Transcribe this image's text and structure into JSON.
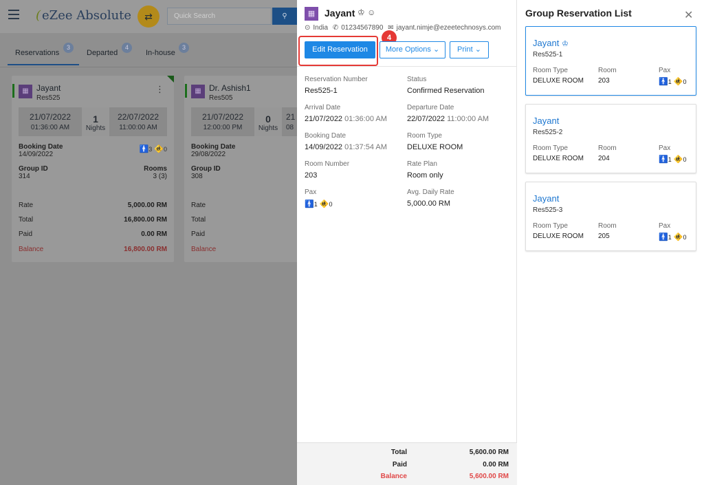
{
  "topbar": {
    "logo": "eZee Absolute",
    "search_placeholder": "Quick Search",
    "search_icon": "search-icon",
    "shuffle_icon": "shuffle-icon"
  },
  "tabs": [
    {
      "label": "Reservations",
      "count": "3"
    },
    {
      "label": "Departed",
      "count": "4"
    },
    {
      "label": "In-house",
      "count": "3"
    }
  ],
  "cards": [
    {
      "name": "Jayant",
      "res": "Res525",
      "arr_date": "21/07/2022",
      "arr_time": "01:36:00 AM",
      "nights": "1",
      "nights_label": "Nights",
      "dep_date": "22/07/2022",
      "dep_time": "11:00:00 AM",
      "booking_label": "Booking Date",
      "booking_date": "14/09/2022",
      "adults": "3",
      "children": "0",
      "group_label": "Group ID",
      "group_id": "314",
      "rooms_label": "Rooms",
      "rooms": "3 (3)",
      "rate_label": "Rate",
      "rate": "5,000.00 RM",
      "total_label": "Total",
      "total": "16,800.00 RM",
      "paid_label": "Paid",
      "paid": "0.00 RM",
      "balance_label": "Balance",
      "balance": "16,800.00 RM"
    },
    {
      "name": "Dr. Ashish1",
      "res": "Res505",
      "arr_date": "21/07/2022",
      "arr_time": "12:00:00 PM",
      "nights": "0",
      "nights_label": "Nights",
      "dep_date": "21",
      "dep_time": "08",
      "booking_label": "Booking Date",
      "booking_date": "29/08/2022",
      "group_label": "Group ID",
      "group_id": "308",
      "rate_label": "Rate",
      "total_label": "Total",
      "paid_label": "Paid",
      "balance_label": "Balance"
    }
  ],
  "panel": {
    "name": "Jayant",
    "country": "India",
    "phone": "01234567890",
    "email": "jayant.nimje@ezeetechnosys.com",
    "edit_label": "Edit Reservation",
    "step_number": "4",
    "more_label": "More Options",
    "print_label": "Print",
    "fields": {
      "res_no_label": "Reservation Number",
      "res_no": "Res525-1",
      "status_label": "Status",
      "status": "Confirmed Reservation",
      "arr_label": "Arrival Date",
      "arr_date": "21/07/2022",
      "arr_time": "01:36:00 AM",
      "dep_label": "Departure Date",
      "dep_date": "22/07/2022",
      "dep_time": "11:00:00 AM",
      "book_label": "Booking Date",
      "book_date": "14/09/2022",
      "book_time": "01:37:54 AM",
      "room_type_label": "Room Type",
      "room_type": "DELUXE ROOM",
      "room_no_label": "Room Number",
      "room_no": "203",
      "rate_plan_label": "Rate Plan",
      "rate_plan": "Room only",
      "pax_label": "Pax",
      "adults": "1",
      "children": "0",
      "adr_label": "Avg. Daily Rate",
      "adr": "5,000.00 RM"
    },
    "footer": {
      "total_label": "Total",
      "total": "5,600.00 RM",
      "paid_label": "Paid",
      "paid": "0.00 RM",
      "balance_label": "Balance",
      "balance": "5,600.00 RM"
    }
  },
  "group": {
    "title": "Group Reservation List",
    "items": [
      {
        "name": "Jayant",
        "res": "Res525-1",
        "room_type_label": "Room Type",
        "room_type": "DELUXE ROOM",
        "room_label": "Room",
        "room": "203",
        "pax_label": "Pax",
        "adults": "1",
        "children": "0"
      },
      {
        "name": "Jayant",
        "res": "Res525-2",
        "room_type_label": "Room Type",
        "room_type": "DELUXE ROOM",
        "room_label": "Room",
        "room": "204",
        "pax_label": "Pax",
        "adults": "1",
        "children": "0"
      },
      {
        "name": "Jayant",
        "res": "Res525-3",
        "room_type_label": "Room Type",
        "room_type": "DELUXE ROOM",
        "room_label": "Room",
        "room": "205",
        "pax_label": "Pax",
        "adults": "1",
        "children": "0"
      }
    ]
  },
  "colors": {
    "primary": "#1e88e5",
    "highlight": "#e53935",
    "balance": "#e04848"
  }
}
